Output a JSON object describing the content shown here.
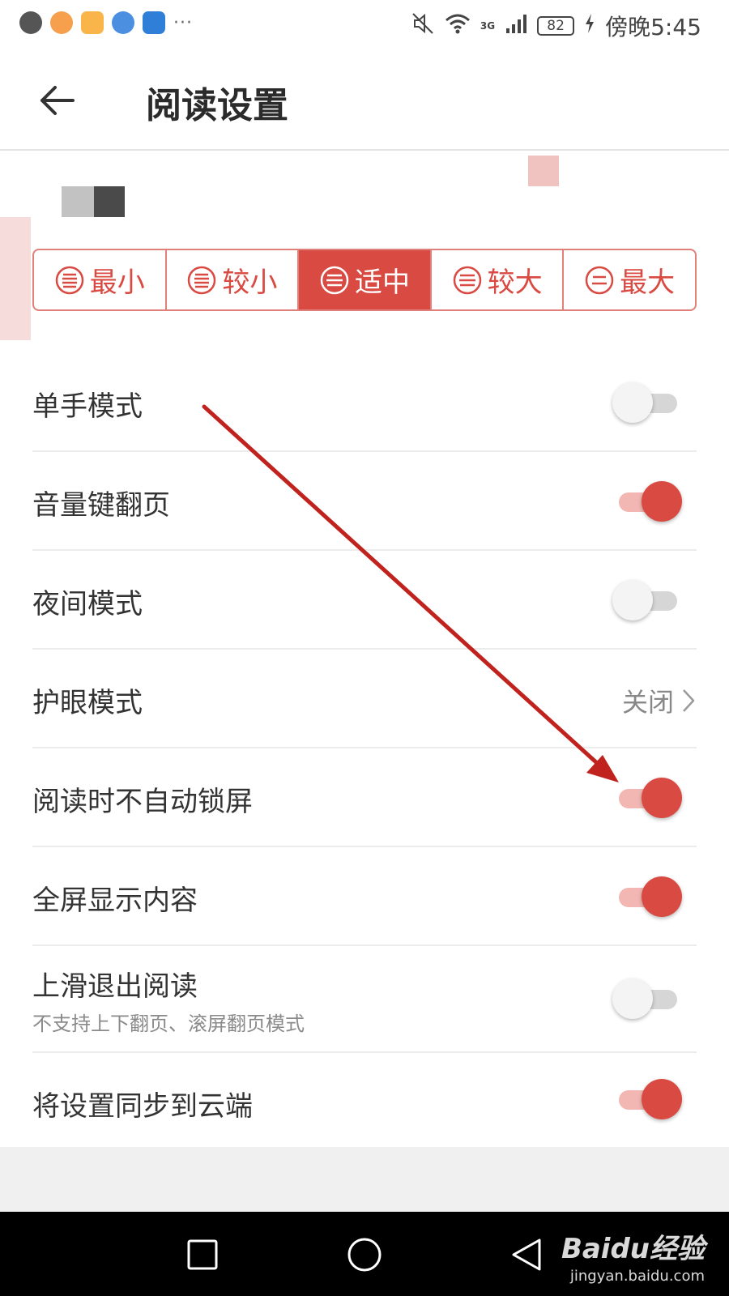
{
  "status_bar": {
    "more_label": "···",
    "network_label": "3G",
    "battery": "82",
    "time": "傍晚5:45"
  },
  "header": {
    "title": "阅读设置"
  },
  "font_size": {
    "options": [
      {
        "label": "最小",
        "active": false
      },
      {
        "label": "较小",
        "active": false
      },
      {
        "label": "适中",
        "active": true
      },
      {
        "label": "较大",
        "active": false
      },
      {
        "label": "最大",
        "active": false
      }
    ]
  },
  "settings": [
    {
      "label": "单手模式",
      "type": "toggle",
      "on": false
    },
    {
      "label": "音量键翻页",
      "type": "toggle",
      "on": true
    },
    {
      "label": "夜间模式",
      "type": "toggle",
      "on": false
    },
    {
      "label": "护眼模式",
      "type": "value",
      "value": "关闭"
    },
    {
      "label": "阅读时不自动锁屏",
      "type": "toggle",
      "on": true
    },
    {
      "label": "全屏显示内容",
      "type": "toggle",
      "on": true
    },
    {
      "label": "上滑退出阅读",
      "sublabel": "不支持上下翻页、滚屏翻页模式",
      "type": "toggle",
      "on": false
    },
    {
      "label": "将设置同步到云端",
      "type": "toggle",
      "on": true
    }
  ],
  "watermark": {
    "brand": "Baidu经验",
    "url": "jingyan.baidu.com"
  },
  "colors": {
    "accent": "#d94a42",
    "annotation_arrow": "#c0231e"
  }
}
